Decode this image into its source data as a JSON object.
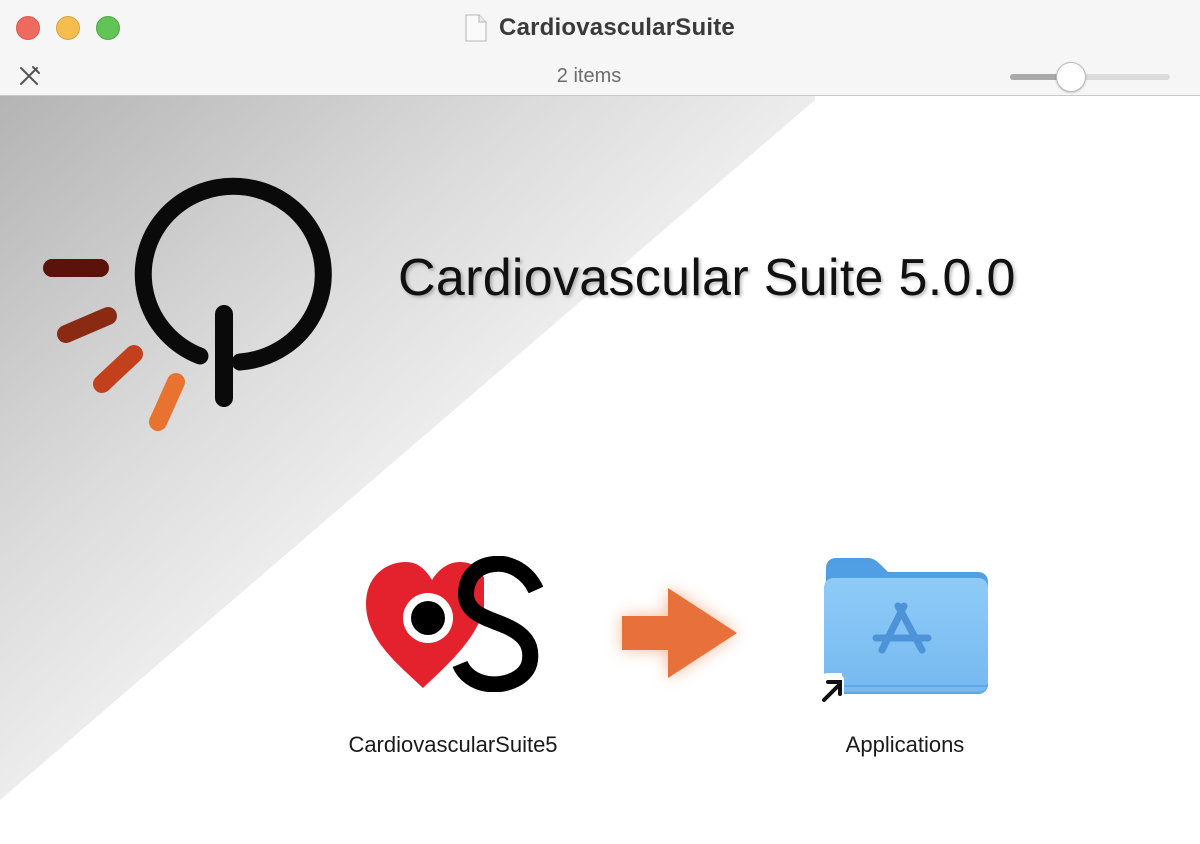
{
  "window": {
    "title": "CardiovascularSuite",
    "item_count": "2 items",
    "icon_size_level": 0.35
  },
  "background": {
    "product_title": "Cardiovascular Suite 5.0.0",
    "logo_colors": [
      "#5a120b",
      "#8a2a12",
      "#c2401b",
      "#e8722f"
    ]
  },
  "items": [
    {
      "label": "CardiovascularSuite5",
      "icon": "cardiovascular-suite-app-icon"
    },
    {
      "label": "Applications",
      "icon": "applications-folder-alias-icon"
    }
  ],
  "colors": {
    "arrow": "#e8703a",
    "heart_red": "#e4222e",
    "folder_blue": "#6fb4ee"
  }
}
